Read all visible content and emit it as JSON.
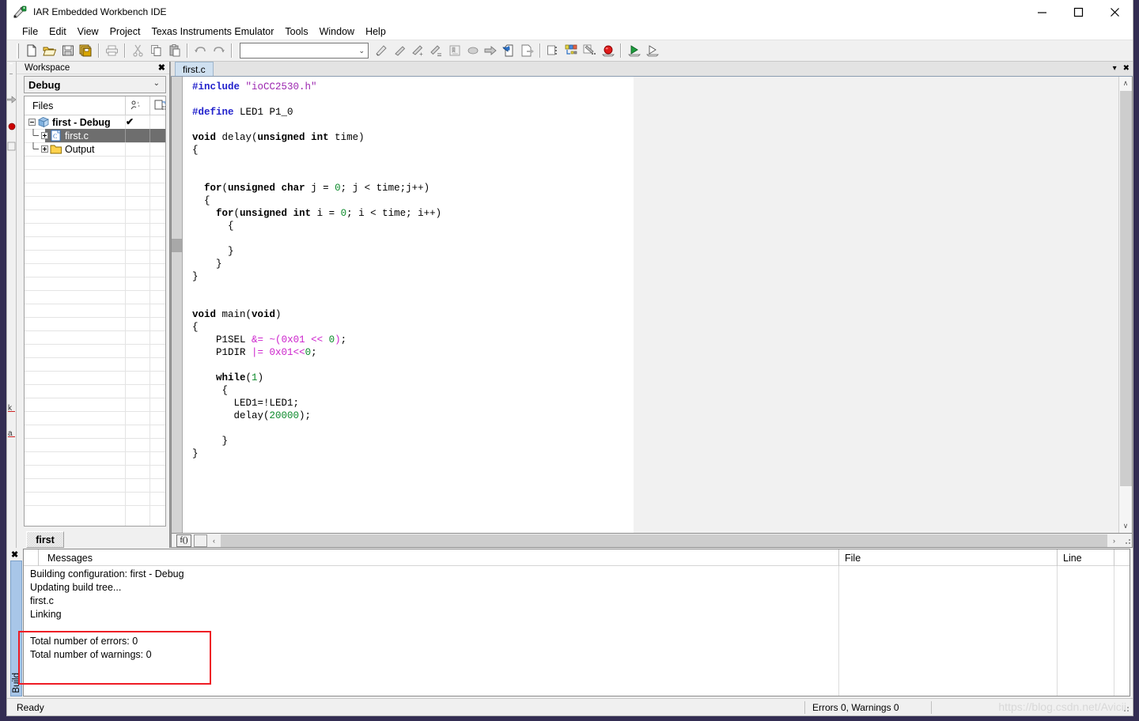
{
  "window": {
    "title": "IAR Embedded Workbench IDE",
    "icon": "iar-app-icon",
    "minimize_label": "–",
    "maximize_label": "☐",
    "close_label": "✕"
  },
  "menubar": {
    "items": [
      {
        "label": "File"
      },
      {
        "label": "Edit"
      },
      {
        "label": "View"
      },
      {
        "label": "Project"
      },
      {
        "label": "Texas Instruments Emulator"
      },
      {
        "label": "Tools"
      },
      {
        "label": "Window"
      },
      {
        "label": "Help"
      }
    ]
  },
  "toolbar": {
    "combo_value": "",
    "combo_arrow": "⌄",
    "buttons": [
      {
        "name": "new-document-icon"
      },
      {
        "name": "open-folder-icon"
      },
      {
        "name": "save-icon"
      },
      {
        "name": "save-all-icon"
      },
      {
        "name": "print-icon"
      },
      {
        "name": "cut-icon"
      },
      {
        "name": "copy-icon"
      },
      {
        "name": "paste-icon"
      },
      {
        "name": "undo-icon"
      },
      {
        "name": "redo-icon"
      },
      {
        "name": "find-icon"
      },
      {
        "name": "find-next-icon"
      },
      {
        "name": "find-previous-icon"
      },
      {
        "name": "replace-icon"
      },
      {
        "name": "goto-bookmark-icon"
      },
      {
        "name": "toggle-bookmark-icon"
      },
      {
        "name": "navigate-forward-icon"
      },
      {
        "name": "compile-icon"
      },
      {
        "name": "make-icon"
      },
      {
        "name": "stop-build-icon"
      },
      {
        "name": "debug-multi-icon"
      },
      {
        "name": "breakpoints-icon"
      },
      {
        "name": "stop-debugger-icon"
      },
      {
        "name": "download-debug-icon"
      },
      {
        "name": "run-icon"
      }
    ]
  },
  "workspace": {
    "panel_title": "Workspace",
    "close_label": "✖",
    "configuration": "Debug",
    "config_chevron": "⌄",
    "files_header": "Files",
    "tree": [
      {
        "label": "first - Debug",
        "icon": "project-cube-icon",
        "indent": 0,
        "bold": true,
        "expander": "minus",
        "selected": false,
        "checked": "✔"
      },
      {
        "label": "first.c",
        "icon": "c-source-file-icon",
        "indent": 1,
        "bold": false,
        "expander": "plus",
        "selected": true,
        "checked": ""
      },
      {
        "label": "Output",
        "icon": "folder-icon",
        "indent": 1,
        "bold": false,
        "expander": "plus",
        "selected": false,
        "checked": ""
      }
    ],
    "bottom_tab": "first"
  },
  "editor": {
    "tabs": [
      {
        "label": "first.c",
        "active": true
      }
    ],
    "tabbar_menu_arrow": "▾",
    "tabbar_close": "✖",
    "function_button": "f()",
    "scroll_up": "∧",
    "scroll_down": "∨",
    "scroll_left": "‹",
    "scroll_right": "›",
    "code_lines": [
      "#include \"ioCC2530.h\"",
      "",
      "#define LED1 P1_0",
      "",
      "void delay(unsigned int time)",
      "{",
      "",
      "",
      "  for(unsigned char j = 0; j < time;j++)",
      "  {",
      "    for(unsigned int i = 0; i < time; i++)",
      "      {",
      "",
      "      }",
      "    }",
      "}",
      "",
      "",
      "void main(void)",
      "{",
      "    P1SEL &= ~(0x01 << 0);",
      "    P1DIR |= 0x01<<0;",
      "",
      "    while(1)",
      "     {",
      "       LED1=!LED1;",
      "       delay(20000);",
      "",
      "     }",
      "}"
    ]
  },
  "build_panel": {
    "close_label": "✖",
    "vertical_tab": "Build",
    "columns": [
      {
        "label": "Messages"
      },
      {
        "label": "File"
      },
      {
        "label": "Line"
      }
    ],
    "messages": [
      "Building configuration: first - Debug",
      "Updating build tree...",
      "first.c",
      "Linking",
      "",
      "Total number of errors: 0",
      "Total number of warnings: 0"
    ],
    "highlight_note": "red-annotation-box around error/warning totals",
    "highlight_color": "#ee1c25"
  },
  "statusbar": {
    "ready": "Ready",
    "errors_warnings": "Errors 0, Warnings 0",
    "watermark": "https://blog.csdn.net/Avicii"
  },
  "colors": {
    "window_bg": "#f0f0f0",
    "editor_bg": "#ffffff",
    "selection_bg": "#6e6e6e",
    "tab_active_bg": "#cfe0f0",
    "preprocessor": "#2222cc",
    "string": "#9c27b0",
    "number": "#0b8a2a",
    "hex_number": "#cc22cc",
    "desktop": "#332d52"
  }
}
